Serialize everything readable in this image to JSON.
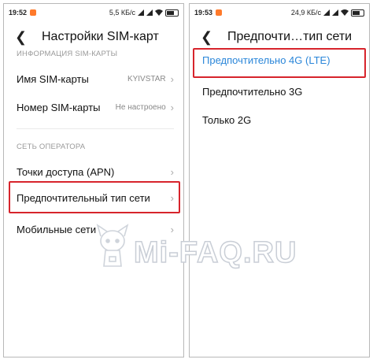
{
  "left": {
    "status": {
      "time": "19:52",
      "speed": "5,5 КБ/с"
    },
    "title": "Настройки SIM-карт",
    "section1": "ИНФОРМАЦИЯ SIM-КАРТЫ",
    "sim_name": {
      "label": "Имя SIM-карты",
      "value": "KYIVSTAR"
    },
    "sim_number": {
      "label": "Номер SIM-карты",
      "value": "Не настроено"
    },
    "section2": "СЕТЬ ОПЕРАТОРА",
    "apn": {
      "label": "Точки доступа (APN)"
    },
    "network_type": {
      "label": "Предпочтительный тип сети"
    },
    "mobile": {
      "label": "Мобильные сети"
    }
  },
  "right": {
    "status": {
      "time": "19:53",
      "speed": "24,9 КБ/с"
    },
    "title": "Предпочти…тип сети",
    "options": [
      "Предпочтительно 4G (LTE)",
      "Предпочтительно 3G",
      "Только 2G"
    ],
    "selected_index": 0
  },
  "watermark": "Mi-FAQ.RU",
  "colors": {
    "accent": "#2a86d9",
    "highlight": "#d7242c",
    "notification": "#ff7a2b"
  }
}
